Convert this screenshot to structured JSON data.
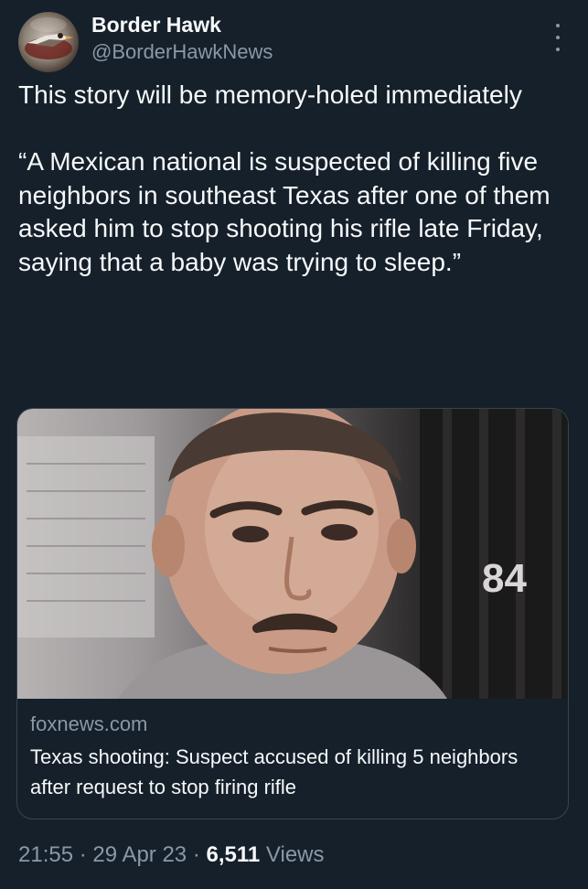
{
  "author": {
    "display_name": "Border Hawk",
    "handle": "@BorderHawkNews"
  },
  "tweet": {
    "text": "This story will be memory-holed immediately\n\n“A Mexican national is suspected of killing five neighbors in southeast Texas after one of them asked him to stop shooting his rifle late Friday, saying that a baby was trying to sleep.”"
  },
  "link_card": {
    "domain": "foxnews.com",
    "title": "Texas shooting: Suspect accused of killing 5 neighbors after request to stop firing rifle",
    "image_overlay_text": "84"
  },
  "meta": {
    "time": "21:55",
    "separator": "·",
    "date": "29 Apr 23",
    "views_count": "6,511",
    "views_label": "Views"
  },
  "icons": {
    "more": "more-options-icon"
  },
  "colors": {
    "background": "#15202b",
    "primary_text": "#f7f9f9",
    "secondary_text": "#8b98a5",
    "border": "#38444d"
  }
}
